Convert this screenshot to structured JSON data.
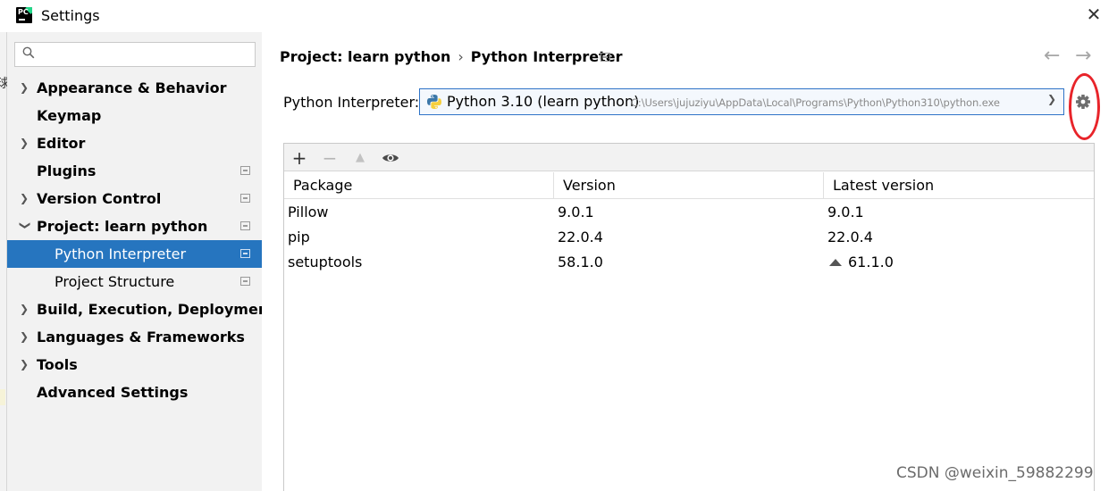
{
  "window": {
    "title": "Settings",
    "close_label": "✕"
  },
  "search": {
    "placeholder": "",
    "value": ""
  },
  "sidebar": {
    "items": [
      {
        "label": "Appearance & Behavior",
        "expandable": true
      },
      {
        "label": "Keymap",
        "expandable": false
      },
      {
        "label": "Editor",
        "expandable": true
      },
      {
        "label": "Plugins",
        "expandable": false
      },
      {
        "label": "Version Control",
        "expandable": true
      },
      {
        "label": "Project: learn python",
        "expandable": true,
        "expanded": true
      },
      {
        "label": "Python Interpreter",
        "sub": true,
        "selected": true
      },
      {
        "label": "Project Structure",
        "sub": true
      },
      {
        "label": "Build, Execution, Deployment",
        "expandable": true
      },
      {
        "label": "Languages & Frameworks",
        "expandable": true
      },
      {
        "label": "Tools",
        "expandable": true
      },
      {
        "label": "Advanced Settings",
        "expandable": false
      }
    ]
  },
  "header": {
    "breadcrumb_project": "Project: learn python",
    "breadcrumb_separator": "›",
    "breadcrumb_page": "Python Interpreter",
    "back_arrow": "←",
    "forward_arrow": "→"
  },
  "interpreter": {
    "label": "Python Interpreter:",
    "name": "Python 3.10 (learn python)",
    "path": "C:\\Users\\jujuziyu\\AppData\\Local\\Programs\\Python\\Python310\\python.exe"
  },
  "toolbar": {
    "add": "+",
    "remove": "−",
    "upgrade": "▲",
    "show": "eye-icon"
  },
  "packages": {
    "columns": [
      "Package",
      "Version",
      "Latest version"
    ],
    "rows": [
      {
        "package": "Pillow",
        "version": "9.0.1",
        "latest": "9.0.1",
        "upgrade": false
      },
      {
        "package": "pip",
        "version": "22.0.4",
        "latest": "22.0.4",
        "upgrade": false
      },
      {
        "package": "setuptools",
        "version": "58.1.0",
        "latest": "61.1.0",
        "upgrade": true
      }
    ]
  },
  "watermark": "CSDN @weixin_59882299",
  "colors": {
    "selection": "#2675bf",
    "sidebar_bg": "#f2f2f2",
    "annotation_circle": "#e8242a",
    "select_border": "#2e73c7"
  }
}
